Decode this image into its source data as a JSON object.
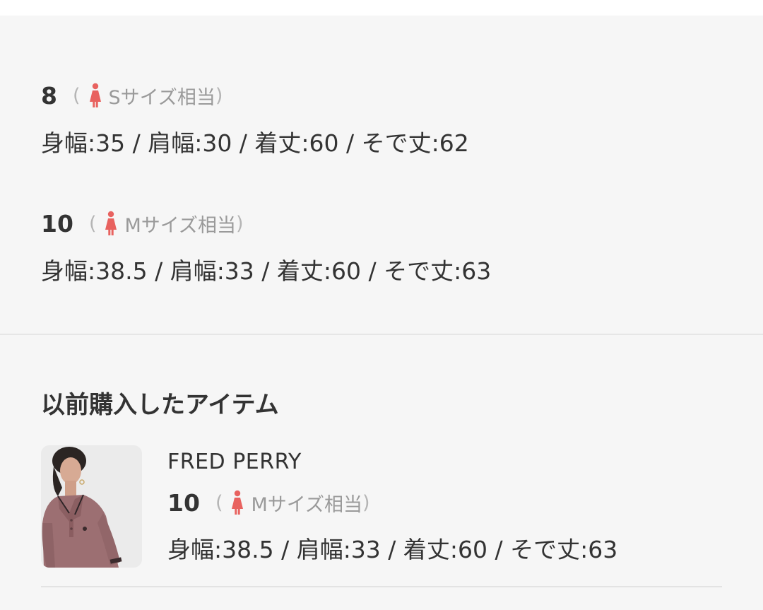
{
  "sizes": [
    {
      "size": "8",
      "paren_open": "(",
      "equivalent": "Sサイズ相当",
      "paren_close": ")",
      "measurements": "身幅:35 / 肩幅:30 / 着丈:60 / そで丈:62"
    },
    {
      "size": "10",
      "paren_open": "(",
      "equivalent": "Mサイズ相当",
      "paren_close": ")",
      "measurements": "身幅:38.5 / 肩幅:33 / 着丈:60 / そで丈:63"
    }
  ],
  "purchased": {
    "title": "以前購入したアイテム",
    "item": {
      "brand": "FRED PERRY",
      "size": "10",
      "paren_open": "(",
      "equivalent": "Mサイズ相当",
      "paren_close": ")",
      "measurements": "身幅:38.5 / 肩幅:33 / 着丈:60 / そで丈:63"
    }
  },
  "icons": {
    "size_equivalent": "female-figure-icon"
  },
  "colors": {
    "background": "#f6f6f6",
    "text_primary": "#333333",
    "text_muted": "#9a9a9a",
    "female_icon": "#e8625f",
    "divider": "#e6e6e6"
  }
}
